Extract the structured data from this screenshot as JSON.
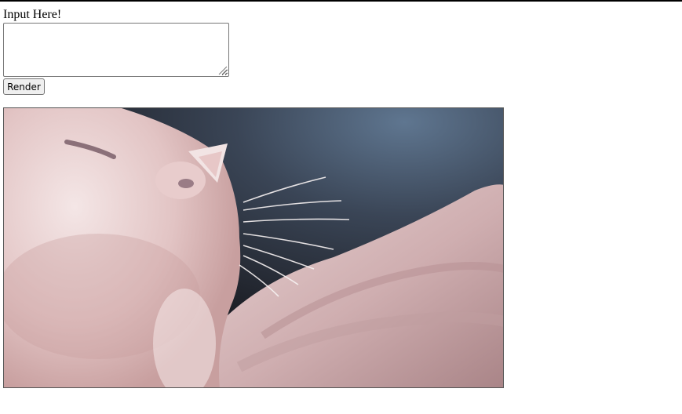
{
  "form": {
    "label": "Input Here!",
    "textarea_value": "",
    "render_button_label": "Render"
  },
  "image": {
    "alt": "cat",
    "subject": "white-cat-closeup"
  },
  "colors": {
    "page_background": "#ffffff",
    "top_rule": "#000000",
    "button_background": "#efefef",
    "control_border": "#767676"
  }
}
